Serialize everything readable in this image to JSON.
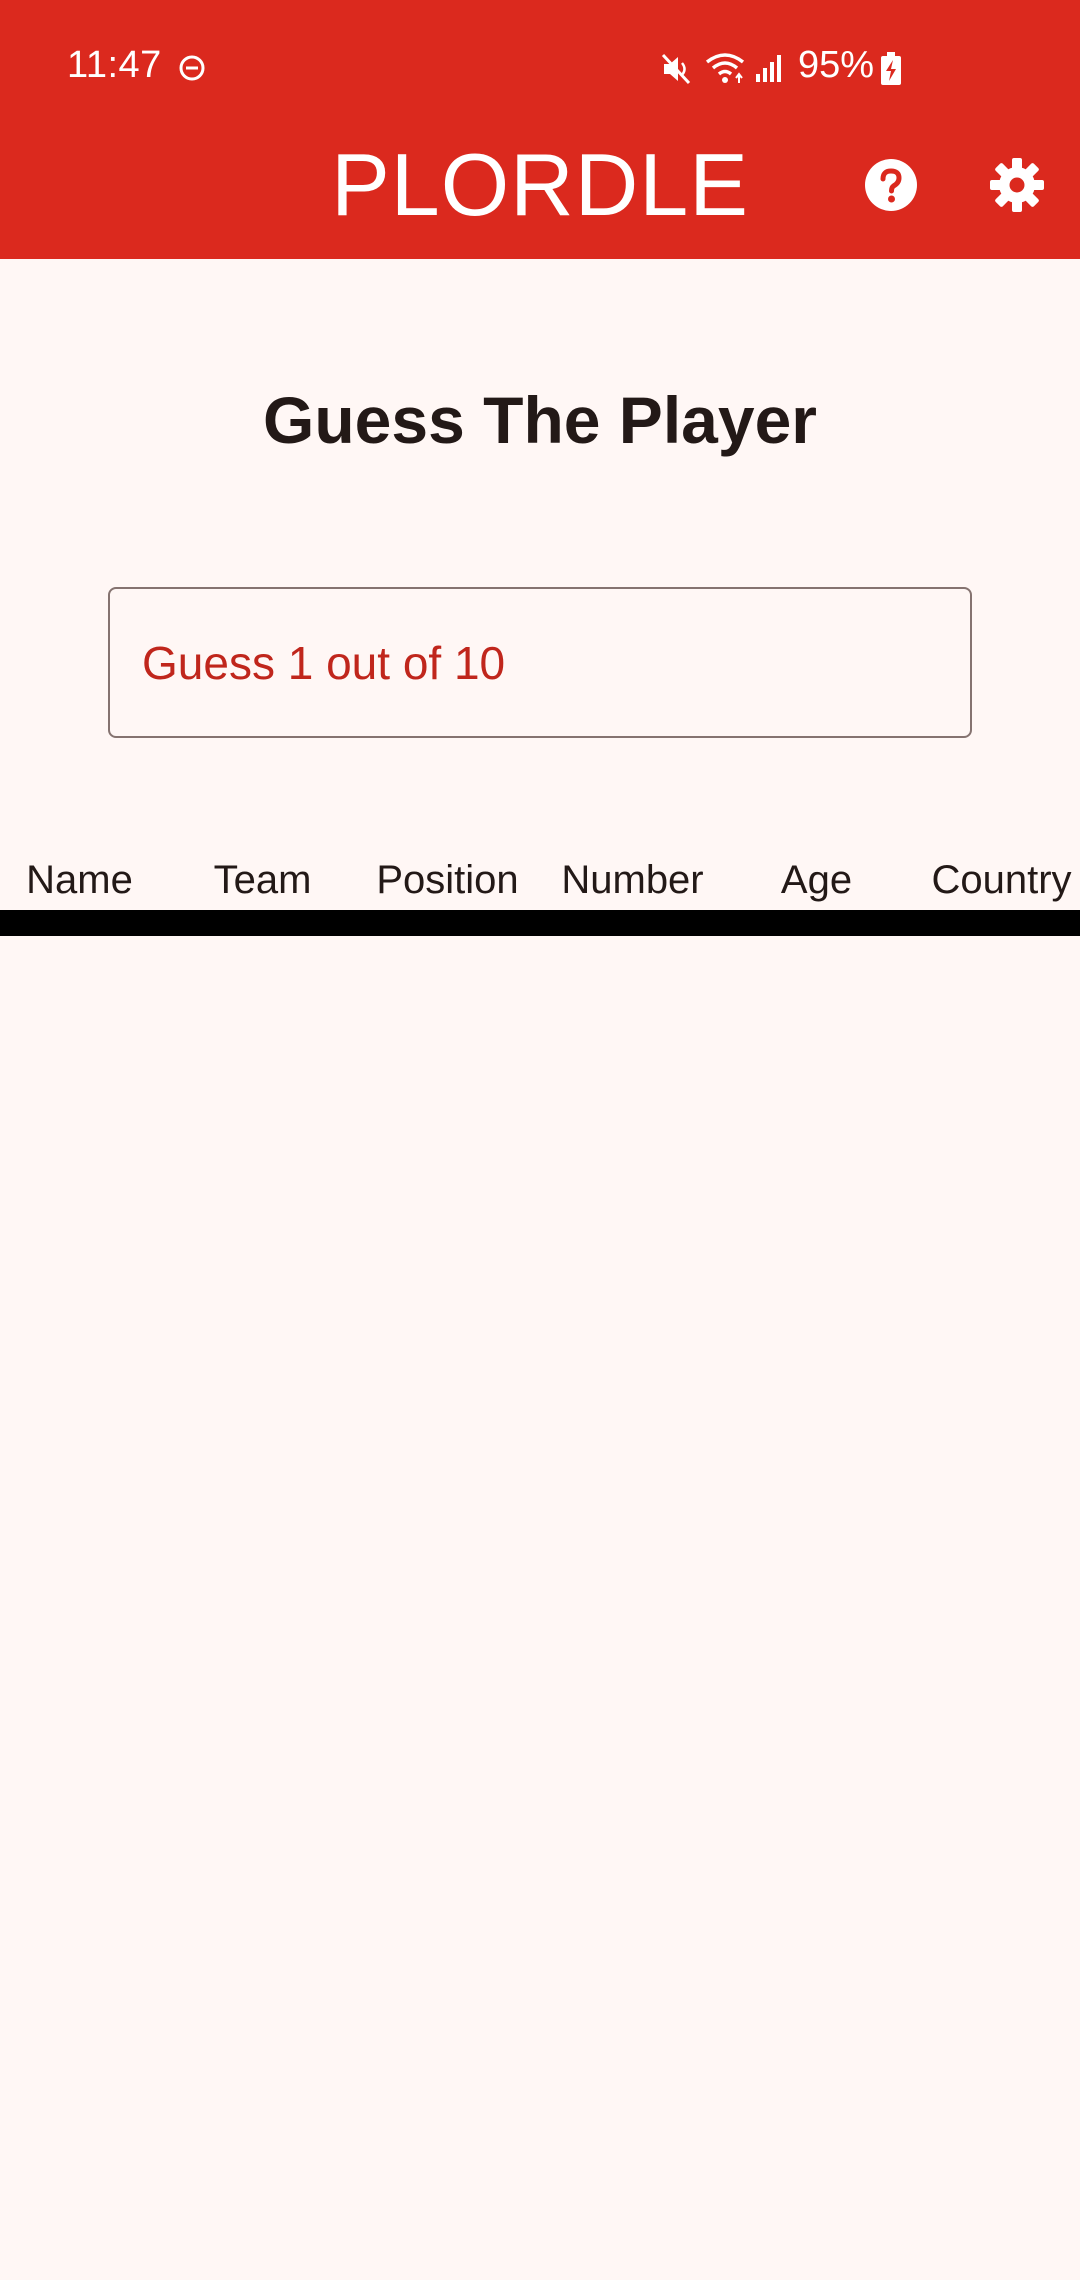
{
  "status_bar": {
    "time": "11:47",
    "battery": "95%",
    "icons": [
      "do-not-disturb-icon",
      "mute-icon",
      "wifi-icon",
      "signal-icon",
      "battery-charging-icon"
    ]
  },
  "app_bar": {
    "title": "PLORDLE",
    "actions": [
      "help-icon",
      "settings-gear-icon"
    ]
  },
  "main": {
    "heading": "Guess The Player",
    "guess_input": {
      "value": "",
      "placeholder": "Guess 1 out of 10"
    },
    "table": {
      "columns": [
        "Name",
        "Team",
        "Position",
        "Number",
        "Age",
        "Country"
      ],
      "rows": []
    }
  },
  "colors": {
    "primary": "#DB291E",
    "background": "#FFF7F5",
    "text": "#231917",
    "hint": "#C0261C"
  }
}
